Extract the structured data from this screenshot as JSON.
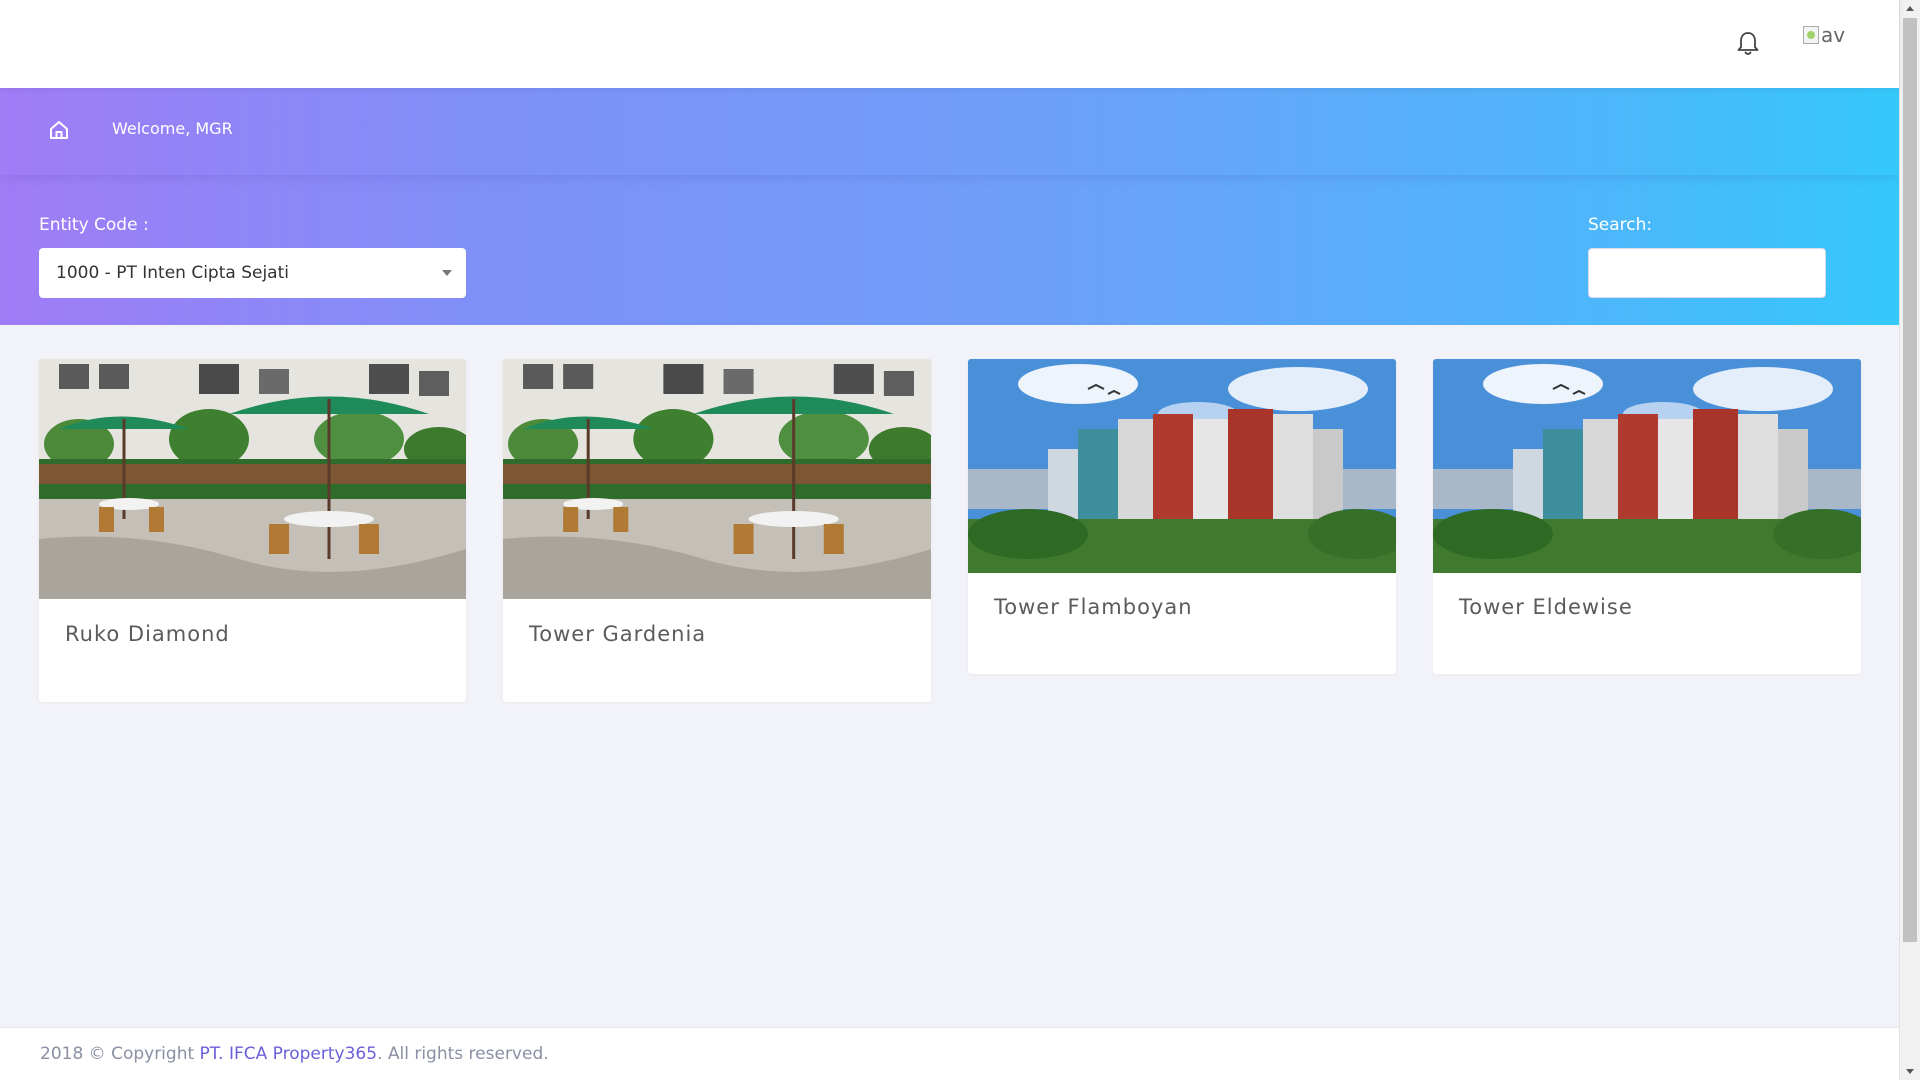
{
  "header": {
    "notification_icon": "bell-icon",
    "avatar_alt": "av"
  },
  "hero": {
    "welcome": "Welcome, MGR",
    "home_icon": "home-icon",
    "entity_label": "Entity Code :",
    "entity_value": "1000 - PT Inten Cipta Sejati",
    "search_label": "Search:",
    "search_value": ""
  },
  "projects": [
    {
      "name": "Ruko Diamond",
      "image": "patio-umbrellas-photo"
    },
    {
      "name": "Tower Gardenia",
      "image": "patio-umbrellas-photo"
    },
    {
      "name": "Tower Flamboyan",
      "image": "apartment-towers-photo"
    },
    {
      "name": "Tower Eldewise",
      "image": "apartment-towers-photo"
    }
  ],
  "footer": {
    "prefix": "2018 © Copyright ",
    "company": "PT. IFCA Property365",
    "suffix": ". All rights reserved."
  },
  "colors": {
    "gradient_start": "#a07cf7",
    "gradient_end": "#35c8fb",
    "page_background": "#f2f3f8",
    "footer_link": "#6a5fd8"
  }
}
